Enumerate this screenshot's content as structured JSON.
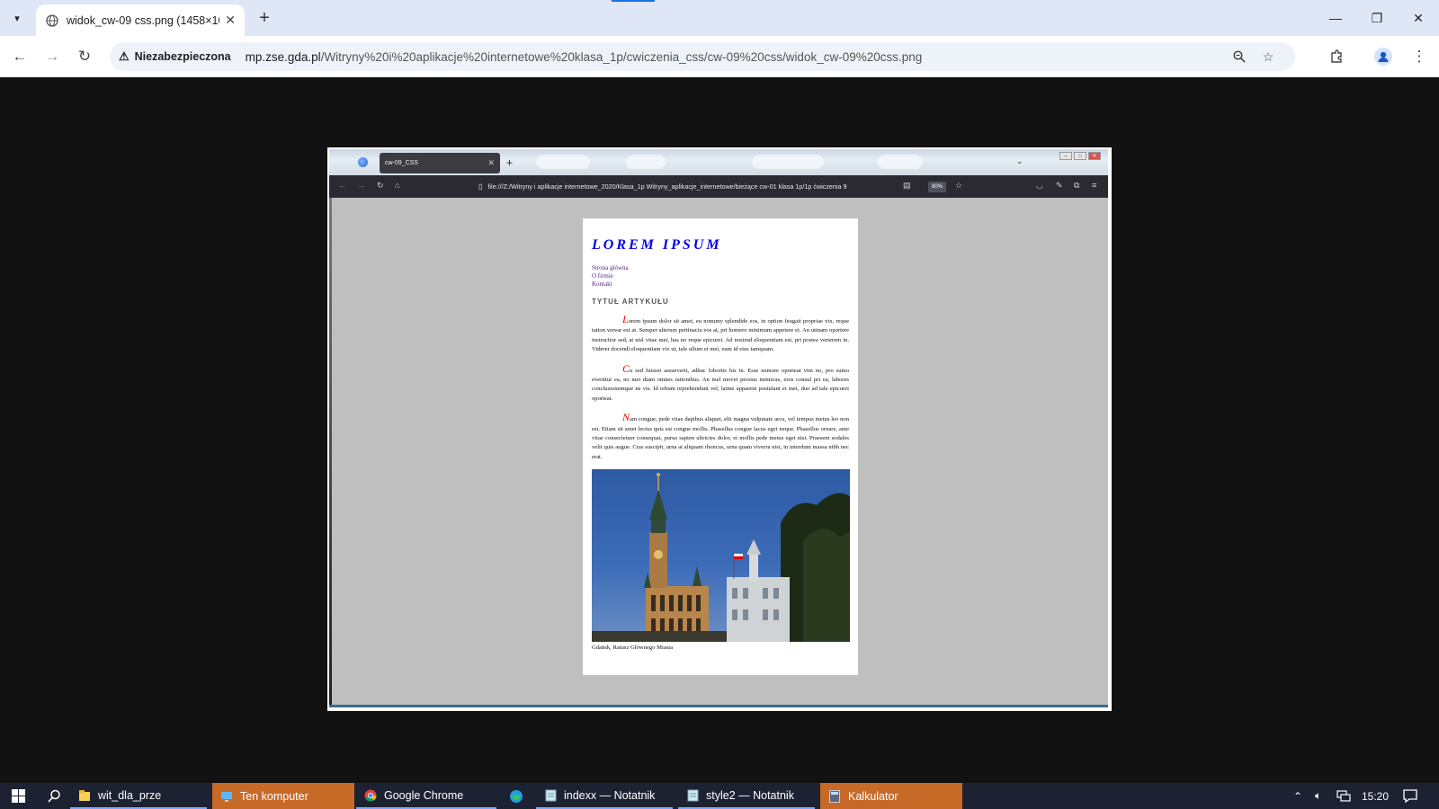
{
  "browser": {
    "tab_title": "widok_cw-09 css.png (1458×10",
    "address": {
      "security_label": "Niezabezpieczona",
      "host": "mp.zse.gda.pl",
      "path": "/Witryny%20i%20aplikacje%20internetowe%20klasa_1p/cwiczenia_css/cw-09%20css/widok_cw-09%20css.png"
    }
  },
  "screenshot": {
    "firefox_tab_title": "cw-09_CSS",
    "firefox_url": "file:///Z:/Witryny i aplikacje internetowe_2020/Klasa_1p Witryny_aplikacje_internetowe/bieżące cw-01 klasa 1p/1p ćwiczenia 9",
    "firefox_zoom": "80%",
    "page": {
      "site_title": "LOREM IPSUM",
      "nav": [
        "Strona główna",
        "O firmie",
        "Kontakt"
      ],
      "article_title": "TYTUŁ ARTYKUŁU",
      "paragraphs": [
        {
          "first": "L",
          "rest": "orem ipsum dolor sit amet, eu nonumy splendide eos, in option feugait propriae vix, reque tation verear est at. Semper alterum pertinacia eos at, pri homero minimum appetere ei. An utinam oportere instructior sed, at nisl vitae mei, has no reque epicurei. Ad nostrud eloquentiam est, pri postea verterem in. Viderer docendi eloquentiam vix ut, tale ullum ei mei, eum id eius tamquam."
        },
        {
          "first": "C",
          "rest": "u sed fuisset assueverit, adhuc lobortis his in. Esse nemore oporteat vim no, pro sumo evertitur ea, no mei diam omnes rationibus. An mel movet persius inimicus, eros consul pri ea, labores conclusionemque ne vis. Id rebum reprehendunt vel, latine apparent postulant ei mei, duo ad tale epicurei oporteat."
        },
        {
          "first": "N",
          "rest": "am congue, pede vitae dapibus aliquet, elit magna vulputate arcu, vel tempus metus leo non est. Etiam sit amet lectus quis est congue mollis. Phasellus congue lacus eget neque. Phasellus ornare, ante vitae consectetuer consequat, purus sapien ultricies dolor, et mollis pede metus eget nisi. Praesent sodales velit quis augue. Cras suscipit, urna at aliquam rhoncus, urna quam viverra nisi, in interdum massa nibh nec erat."
        }
      ],
      "caption": "Gdańsk, Ratusz Głównego Miasta"
    }
  },
  "taskbar": {
    "items": [
      "wit_dla_prze",
      "Ten komputer",
      "Google Chrome",
      "indexx — Notatnik",
      "style2 — Notatnik",
      "Kalkulator"
    ],
    "clock": "15:20"
  },
  "colors": {
    "title_blue": "#0000ee",
    "nav_visited": "#551a8b",
    "initial_red": "#ee0000",
    "taskbar_orange": "#c76a28"
  }
}
